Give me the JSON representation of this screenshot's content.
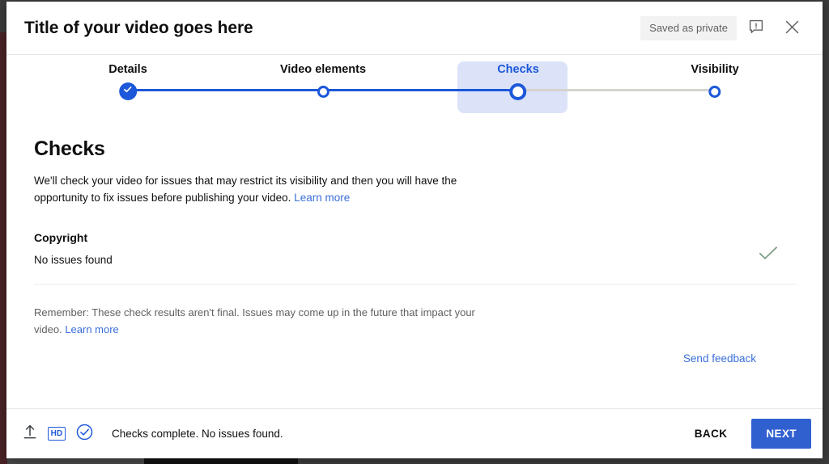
{
  "backdrop": {
    "page_background": "#3b3b3b",
    "accent_strip": "#4a2226"
  },
  "header": {
    "title": "Title of your video goes here",
    "saved_status": "Saved as private",
    "feedback_icon": "feedback-speech-bubble-icon",
    "close_icon": "close-icon"
  },
  "stepper": {
    "active_index": 2,
    "steps": [
      {
        "label": "Details",
        "state": "complete"
      },
      {
        "label": "Video elements",
        "state": "pending"
      },
      {
        "label": "Checks",
        "state": "current"
      },
      {
        "label": "Visibility",
        "state": "pending"
      }
    ],
    "colors": {
      "active": "#1c58d9",
      "inactive_line": "#d5d3cf",
      "highlight_bg": "#dce3f9"
    }
  },
  "main": {
    "section_title": "Checks",
    "description_text": "We'll check your video for issues that may restrict its visibility and then you will have the opportunity to fix issues before publishing your video. ",
    "description_link": "Learn more",
    "checks": [
      {
        "name": "Copyright",
        "status": "No issues found",
        "result_icon": "checkmark-icon",
        "result_icon_color": "#7f9f87"
      }
    ],
    "remember_text": "Remember: These check results aren't final. Issues may come up in the future that impact your video. ",
    "remember_link": "Learn more",
    "feedback_link": "Send feedback"
  },
  "footer": {
    "upload_icon": "upload-arrow-icon",
    "hd_badge_label": "HD",
    "checks_icon": "circled-checkmark-icon",
    "status_text": "Checks complete. No issues found.",
    "back_label": "BACK",
    "next_label": "NEXT",
    "next_color": "#3060d0"
  }
}
